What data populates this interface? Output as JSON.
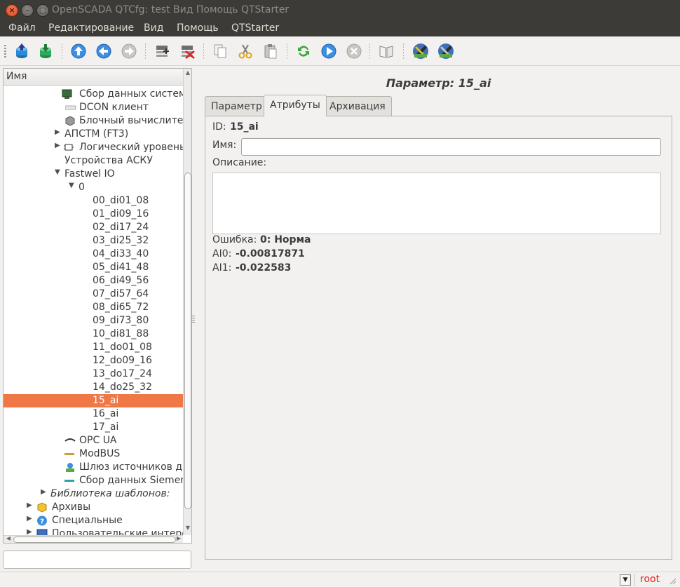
{
  "window": {
    "title": "OpenSCADA QTCfg: test Вид  Помощь  QTStarter"
  },
  "menu": [
    "Файл",
    "Редактирование",
    "Вид",
    "Помощь",
    "QTStarter"
  ],
  "toolbar": {
    "buttons": [
      "db-load-icon",
      "db-save-icon",
      "up-icon",
      "back-icon",
      "forward-icon",
      "item-add-icon",
      "item-delete-icon",
      "copy-icon",
      "cut-icon",
      "paste-icon",
      "refresh-icon",
      "start-icon",
      "stop-icon",
      "manual-icon",
      "tool-1-icon",
      "tool-2-icon"
    ]
  },
  "tree": {
    "header": "Имя",
    "rows": [
      {
        "text": "Сбор данных системы",
        "icon": "monitor-icon"
      },
      {
        "text": "DCON клиент",
        "icon": "dcon-icon"
      },
      {
        "text": "Блочный вычислител",
        "icon": "block-icon"
      },
      {
        "text": "АПСТМ (FT3)"
      },
      {
        "text": "Логический уровень",
        "icon": "logic-icon"
      },
      {
        "text": "Устройства АСКУ"
      },
      {
        "text": "Fastwel IO"
      },
      {
        "text": "0"
      },
      {
        "text": "00_di01_08"
      },
      {
        "text": "01_di09_16"
      },
      {
        "text": "02_di17_24"
      },
      {
        "text": "03_di25_32"
      },
      {
        "text": "04_di33_40"
      },
      {
        "text": "05_di41_48"
      },
      {
        "text": "06_di49_56"
      },
      {
        "text": "07_di57_64"
      },
      {
        "text": "08_di65_72"
      },
      {
        "text": "09_di73_80"
      },
      {
        "text": "10_di81_88"
      },
      {
        "text": "11_do01_08"
      },
      {
        "text": "12_do09_16"
      },
      {
        "text": "13_do17_24"
      },
      {
        "text": "14_do25_32"
      },
      {
        "text": "15_ai",
        "selected": true
      },
      {
        "text": "16_ai"
      },
      {
        "text": "17_ai"
      },
      {
        "text": "OPC UA",
        "icon": "opcua-icon"
      },
      {
        "text": "ModBUS",
        "icon": "modbus-icon"
      },
      {
        "text": "Шлюз источников да",
        "icon": "gateway-icon"
      },
      {
        "text": "Сбор данных Siemens",
        "icon": "siemens-icon"
      },
      {
        "text": "Библиотека шаблонов:"
      },
      {
        "text": "Архивы",
        "icon": "archive-icon"
      },
      {
        "text": "Специальные",
        "icon": "help-icon"
      },
      {
        "text": "Пользовательские интерф",
        "icon": "ui-icon"
      }
    ]
  },
  "param": {
    "title": "Параметр: 15_ai",
    "tabs": [
      "Параметр",
      "Атрибуты",
      "Архивация"
    ],
    "active_tab": "Атрибуты",
    "id_label": "ID:",
    "id_value": "15_ai",
    "name_label": "Имя:",
    "name_value": "",
    "descr_label": "Описание:",
    "error_label": "Ошибка:",
    "error_value": "0: Норма",
    "ai0_label": "AI0:",
    "ai0_value": "-0.00817871",
    "ai1_label": "AI1:",
    "ai1_value": "-0.022583"
  },
  "status": {
    "user": "root"
  },
  "colors": {
    "selection": "#f07746",
    "status_user": "#e0231b"
  }
}
